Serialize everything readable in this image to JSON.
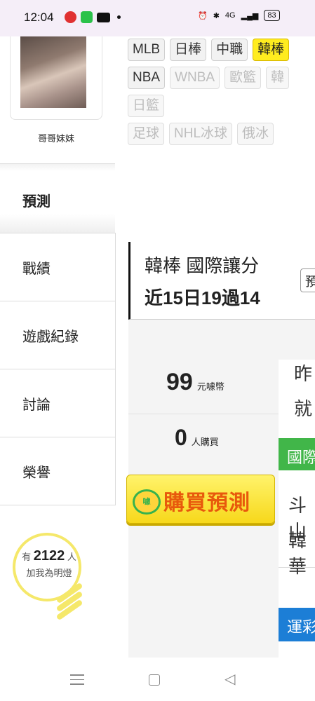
{
  "status": {
    "time": "12:04",
    "battery": "83",
    "network": "4G"
  },
  "profile": {
    "name": "哥哥妹妹"
  },
  "menu": {
    "active": "預測",
    "items": [
      "戰績",
      "遊戲紀錄",
      "討論",
      "榮譽"
    ]
  },
  "fans": {
    "prefix": "有",
    "count": "2122",
    "suffix": "人",
    "line2": "加我為明燈"
  },
  "categories": {
    "row1": [
      "MLB",
      "日棒",
      "中職",
      "韓棒"
    ],
    "row2": [
      "NBA",
      "WNBA",
      "歐籃",
      "韓"
    ],
    "row3": [
      "日籃"
    ],
    "row4": [
      "足球",
      "NHL冰球",
      "俄冰"
    ],
    "active": "韓棒"
  },
  "prediction": {
    "title": "韓棒 國際讓分",
    "record": "近15日19過14",
    "button_label": "預",
    "price": "99",
    "price_unit": "元噱幣",
    "buyers": "0",
    "buyers_unit": "人購買",
    "buy_label": "購買預測",
    "coin_label": "噱",
    "right_text1": "昨",
    "right_text2": "就",
    "tag1": "國際",
    "right_text3": "斗山",
    "right_text4": "韓華",
    "tag2": "運彩"
  }
}
